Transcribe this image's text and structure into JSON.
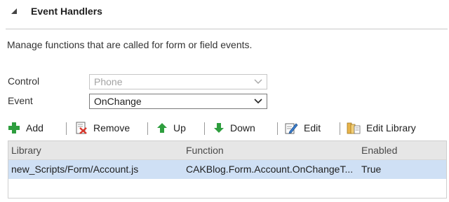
{
  "section": {
    "title": "Event Handlers"
  },
  "description": "Manage functions that are called for form or field events.",
  "fields": {
    "control": {
      "label": "Control",
      "value": "Phone"
    },
    "event": {
      "label": "Event",
      "value": "OnChange"
    }
  },
  "toolbar": {
    "add": "Add",
    "remove": "Remove",
    "up": "Up",
    "down": "Down",
    "edit": "Edit",
    "edit_library": "Edit Library"
  },
  "grid": {
    "columns": [
      "Library",
      "Function",
      "Enabled"
    ],
    "rows": [
      [
        "new_Scripts/Form/Account.js",
        "CAKBlog.Form.Account.OnChangeT...",
        "True"
      ]
    ]
  },
  "colors": {
    "selected_row": "#cfe0f5",
    "header_row": "#e6e6e6",
    "add_icon": "#2e9e3e",
    "arrow_icon": "#2e9e3e"
  }
}
